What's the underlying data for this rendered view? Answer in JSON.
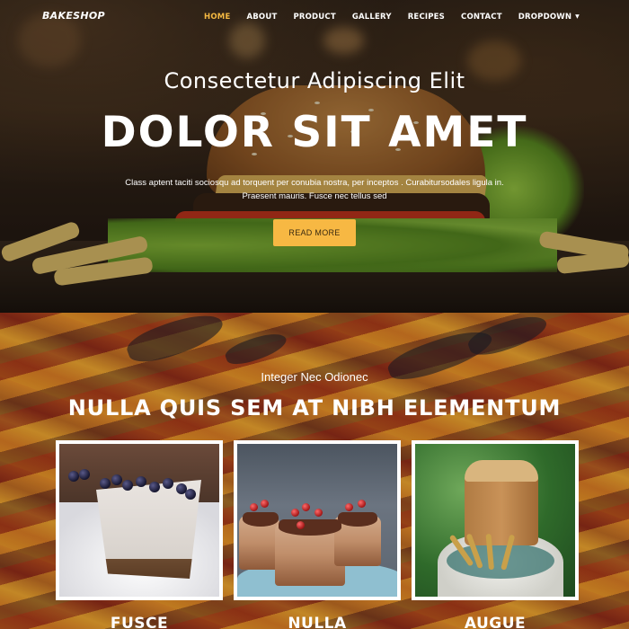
{
  "nav": {
    "brand": "BAKESHOP",
    "items": [
      {
        "label": "HOME",
        "active": true
      },
      {
        "label": "ABOUT"
      },
      {
        "label": "PRODUCT"
      },
      {
        "label": "GALLERY"
      },
      {
        "label": "RECIPES"
      },
      {
        "label": "CONTACT"
      },
      {
        "label": "DROPDOWN"
      }
    ]
  },
  "hero": {
    "subtitle": "Consectetur Adipiscing Elit",
    "title": "DOLOR SIT AMET",
    "description": "Class aptent taciti sociosqu ad torquent per conubia nostra, per inceptos . Curabitursodales ligula in. Praesent mauris. Fusce nec tellus sed",
    "button_label": "READ MORE"
  },
  "section": {
    "subtitle": "Integer Nec Odionec",
    "title": "NULLA QUIS SEM AT NIBH ELEMENTUM",
    "cards": [
      {
        "caption": "FUSCE"
      },
      {
        "caption": "NULLA"
      },
      {
        "caption": "AUGUE"
      }
    ]
  },
  "colors": {
    "accent": "#f7b843",
    "active_nav": "#f5b942"
  }
}
